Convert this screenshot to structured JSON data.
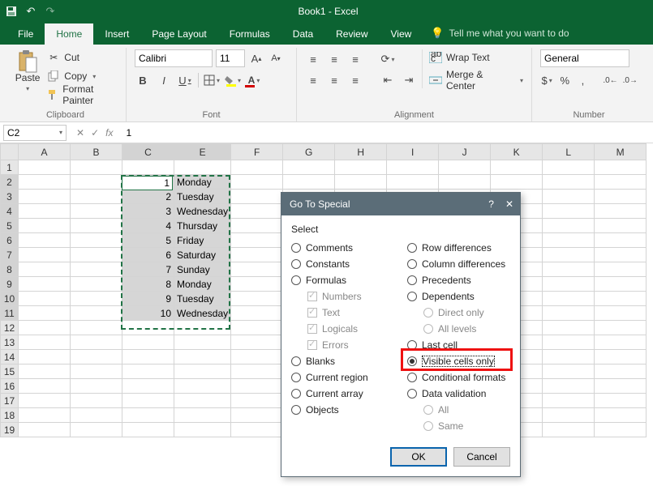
{
  "titlebar": {
    "title": "Book1 - Excel"
  },
  "tabs": {
    "file": "File",
    "home": "Home",
    "insert": "Insert",
    "pagelayout": "Page Layout",
    "formulas": "Formulas",
    "data": "Data",
    "review": "Review",
    "view": "View",
    "tellme": "Tell me what you want to do"
  },
  "ribbon": {
    "clipboard": {
      "paste": "Paste",
      "cut": "Cut",
      "copy": "Copy",
      "formatpainter": "Format Painter",
      "label": "Clipboard"
    },
    "font": {
      "name": "Calibri",
      "size": "11",
      "label": "Font"
    },
    "alignment": {
      "wrap": "Wrap Text",
      "merge": "Merge & Center",
      "label": "Alignment"
    },
    "number": {
      "format": "General",
      "label": "Number"
    }
  },
  "formulabar": {
    "namebox": "C2",
    "value": "1"
  },
  "columns": [
    "A",
    "B",
    "C",
    "E",
    "F",
    "G",
    "H",
    "I",
    "J",
    "K",
    "L",
    "M"
  ],
  "rows": [
    {
      "n": 1
    },
    {
      "n": 2,
      "c": "1",
      "e": "Monday"
    },
    {
      "n": 3,
      "c": "2",
      "e": "Tuesday"
    },
    {
      "n": 4,
      "c": "3",
      "e": "Wednesday"
    },
    {
      "n": 5,
      "c": "4",
      "e": "Thursday"
    },
    {
      "n": 6,
      "c": "5",
      "e": "Friday"
    },
    {
      "n": 7,
      "c": "6",
      "e": "Saturday"
    },
    {
      "n": 8,
      "c": "7",
      "e": "Sunday"
    },
    {
      "n": 9,
      "c": "8",
      "e": "Monday"
    },
    {
      "n": 10,
      "c": "9",
      "e": "Tuesday"
    },
    {
      "n": 11,
      "c": "10",
      "e": "Wednesday"
    },
    {
      "n": 12
    },
    {
      "n": 13
    },
    {
      "n": 14
    },
    {
      "n": 15
    },
    {
      "n": 16
    },
    {
      "n": 17
    },
    {
      "n": 18
    },
    {
      "n": 19
    }
  ],
  "dialog": {
    "title": "Go To Special",
    "section": "Select",
    "left": {
      "comments": "Comments",
      "constants": "Constants",
      "formulas": "Formulas",
      "numbers": "Numbers",
      "text": "Text",
      "logicals": "Logicals",
      "errors": "Errors",
      "blanks": "Blanks",
      "currentregion": "Current region",
      "currentarray": "Current array",
      "objects": "Objects"
    },
    "right": {
      "rowdiff": "Row differences",
      "coldiff": "Column differences",
      "precedents": "Precedents",
      "dependents": "Dependents",
      "directonly": "Direct only",
      "alllevels": "All levels",
      "lastcell": "Last cell",
      "visible": "Visible cells only",
      "condfmt": "Conditional formats",
      "datavalid": "Data validation",
      "all": "All",
      "same": "Same"
    },
    "ok": "OK",
    "cancel": "Cancel"
  }
}
